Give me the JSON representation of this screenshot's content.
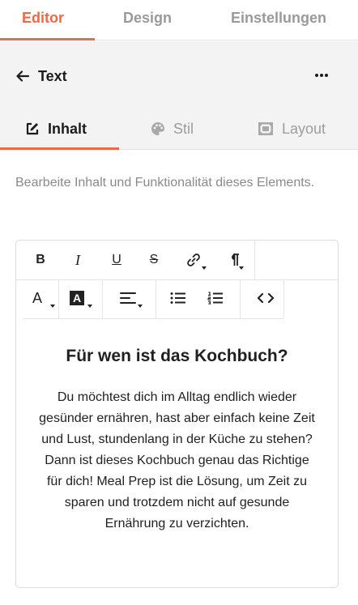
{
  "top_tabs": {
    "editor": "Editor",
    "design": "Design",
    "settings": "Einstellungen"
  },
  "panel": {
    "title": "Text"
  },
  "sub_tabs": {
    "content": "Inhalt",
    "style": "Stil",
    "layout": "Layout"
  },
  "description": "Bearbeite Inhalt und Funktionalität dieses Elements.",
  "toolbar": {
    "bold": "B",
    "italic": "I",
    "underline": "U",
    "strike": "S",
    "font_color": "A",
    "bg_color": "A"
  },
  "content": {
    "heading": "Für wen ist das Kochbuch?",
    "body": "Du möchtest dich im Alltag endlich wieder gesünder ernähren, hast aber einfach keine Zeit und Lust, stundenlang in der Küche zu stehen? Dann ist dieses Kochbuch genau das Richtige für dich! Meal Prep ist die Lösung, um Zeit zu sparen und trotzdem nicht auf gesunde Ernährung zu verzichten."
  },
  "colors": {
    "accent": "#ea6a4a",
    "inactive_text": "#9a9a9a",
    "panel_bg": "#f3f3f3"
  }
}
